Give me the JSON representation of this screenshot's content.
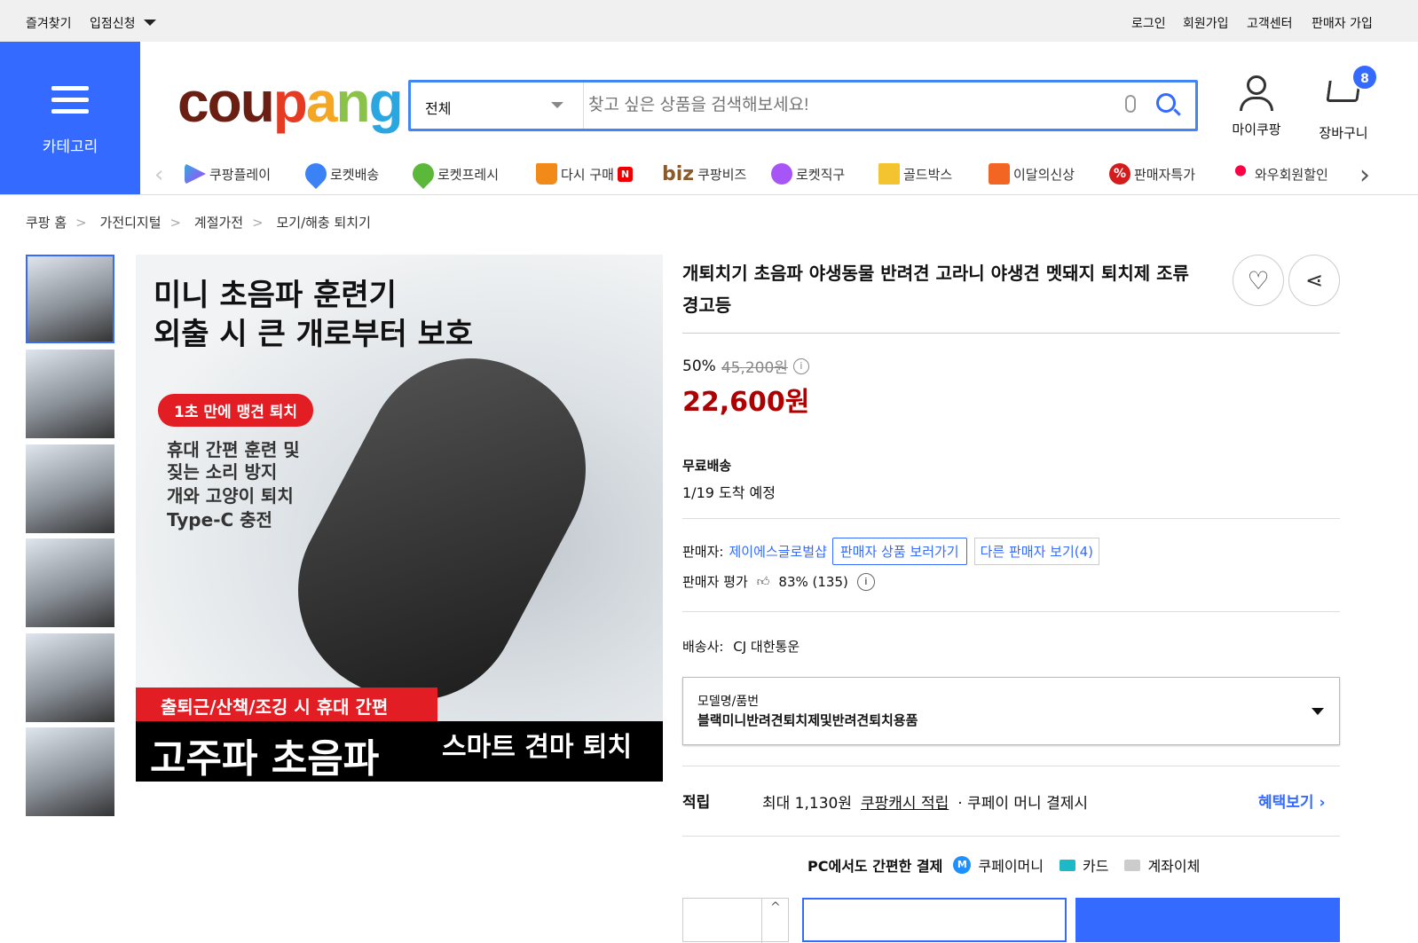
{
  "topbar": {
    "left": [
      "즐겨찾기",
      "입점신청"
    ],
    "right": [
      "로그인",
      "회원가입",
      "고객센터",
      "판매자 가입"
    ]
  },
  "header": {
    "category_label": "카테고리",
    "logo": "coupang",
    "search_category": "전체",
    "search_placeholder": "찾고 싶은 상품을 검색해보세요!",
    "mycoupang": "마이쿠팡",
    "cart": "장바구니",
    "cart_count": "8"
  },
  "nav": [
    "쿠팡플레이",
    "로켓배송",
    "로켓프레시",
    "다시 구매",
    "쿠팡비즈",
    "로켓직구",
    "골드박스",
    "이달의신상",
    "판매자특가",
    "와우회원할인"
  ],
  "nav_biz_prefix": "biz",
  "breadcrumb": [
    "쿠팡 홈",
    "가전디지털",
    "계절가전",
    "모기/해충 퇴치기"
  ],
  "image_text": {
    "headline1": "미니 초음파 훈련기",
    "headline2": "외출 시 큰 개로부터 보호",
    "badge": "1초 만에 맹견 퇴치",
    "bullets": [
      "휴대 간편 훈련 및 짖는 소리 방지",
      "개와 고양이 퇴치",
      "Type-C 충전"
    ],
    "red_banner": "출퇴근/산책/조깅 시 휴대 간편",
    "bottom_big": "고주파 초음파",
    "bottom_small": "스마트 견마 퇴치"
  },
  "product": {
    "title": "개퇴치기 초음파 야생동물 반려견 고라니 야생견 멧돼지 퇴치제 조류 경고등",
    "discount": "50%",
    "original_price": "45,200원",
    "price": "22,600원",
    "shipping": "무료배송",
    "arrival": "1/19 도착 예정",
    "seller_label": "판매자:",
    "seller": "제이에스글로벌샵",
    "seller_products_btn": "판매자 상품 보러가기",
    "other_sellers_btn": "다른 판매자 보기(4)",
    "rating_label": "판매자 평가",
    "rating": "83% (135)",
    "carrier_label": "배송사:",
    "carrier": "CJ 대한통운",
    "option_label": "모델명/품번",
    "option_value": "블랙미니반려견퇴치제및반려견퇴치용품",
    "reward_label": "적립",
    "reward_text": "최대 1,130원",
    "reward_link": "쿠팡캐시 적립",
    "reward_suffix": "· 쿠페이 머니 결제시",
    "benefit_link": "혜택보기 ›",
    "pay_title": "PC에서도 간편한 결제",
    "pay_methods": [
      "쿠페이머니",
      "카드",
      "계좌이체"
    ]
  },
  "colors": {
    "brand_blue": "#346aff",
    "price_red": "#ae0000",
    "link_blue": "#346aff"
  }
}
